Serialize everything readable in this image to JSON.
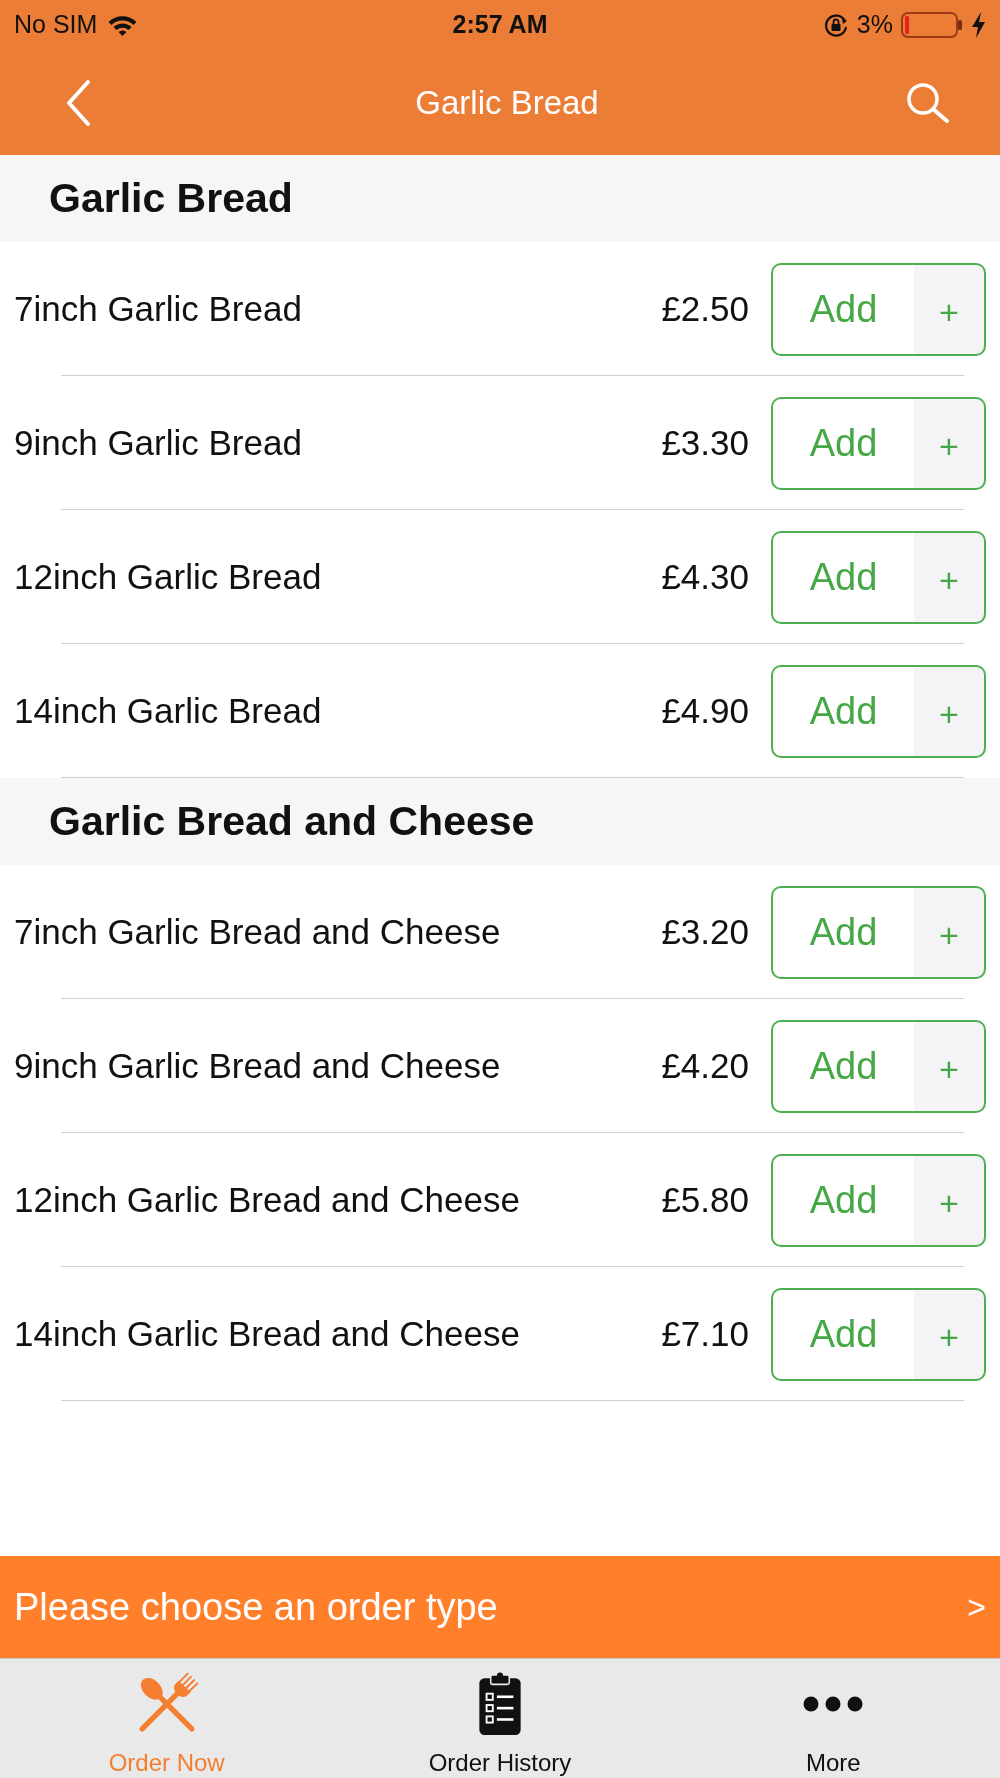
{
  "status_bar": {
    "carrier": "No SIM",
    "time": "2:57 AM",
    "battery": "3%"
  },
  "nav_bar": {
    "title": "Garlic Bread"
  },
  "sections": [
    {
      "title": "Garlic Bread",
      "items": [
        {
          "name": "7inch Garlic Bread",
          "price": "£2.50",
          "add_label": "Add",
          "plus_label": "+"
        },
        {
          "name": "9inch Garlic Bread",
          "price": "£3.30",
          "add_label": "Add",
          "plus_label": "+"
        },
        {
          "name": "12inch Garlic Bread",
          "price": "£4.30",
          "add_label": "Add",
          "plus_label": "+"
        },
        {
          "name": "14inch Garlic Bread",
          "price": "£4.90",
          "add_label": "Add",
          "plus_label": "+"
        }
      ]
    },
    {
      "title": "Garlic Bread and Cheese",
      "items": [
        {
          "name": "7inch Garlic Bread and Cheese",
          "price": "£3.20",
          "add_label": "Add",
          "plus_label": "+"
        },
        {
          "name": "9inch Garlic Bread and Cheese",
          "price": "£4.20",
          "add_label": "Add",
          "plus_label": "+"
        },
        {
          "name": "12inch Garlic Bread and Cheese",
          "price": "£5.80",
          "add_label": "Add",
          "plus_label": "+"
        },
        {
          "name": "14inch Garlic Bread and Cheese",
          "price": "£7.10",
          "add_label": "Add",
          "plus_label": "+"
        }
      ]
    }
  ],
  "order_bar": {
    "prompt": "Please choose an order type",
    "arrow": ">"
  },
  "tab_bar": [
    {
      "label": "Order Now",
      "selected": true
    },
    {
      "label": "Order History",
      "selected": false
    },
    {
      "label": "More",
      "selected": false
    }
  ]
}
